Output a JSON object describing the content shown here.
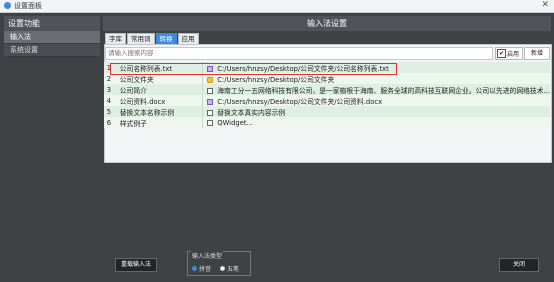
{
  "window": {
    "title": "设置面板",
    "close_label": "✕"
  },
  "sidebar": {
    "header": "设置功能",
    "items": [
      {
        "label": "输入法",
        "active": true
      },
      {
        "label": "系统设置",
        "active": false
      }
    ]
  },
  "main": {
    "header": "输入法设置",
    "tabs": [
      {
        "label": "字库",
        "active": false
      },
      {
        "label": "常用词",
        "active": false
      },
      {
        "label": "转换",
        "active": true
      },
      {
        "label": "应用",
        "active": false
      }
    ],
    "search": {
      "placeholder": "请输入搜索内容",
      "value": ""
    },
    "enable_label": "启用",
    "enable_checked": true,
    "new_label": "新增",
    "rows": [
      {
        "num": "1",
        "name": "公司名称列表.txt",
        "icon": "txt-file-icon",
        "value": "C:/Users/hnzsy/Desktop/公司文件夹/公司名称列表.txt"
      },
      {
        "num": "2",
        "name": "公司文件夹",
        "icon": "folder-icon",
        "value": "C:/Users/hnzsy/Desktop/公司文件夹"
      },
      {
        "num": "3",
        "name": "公司简介",
        "icon": "document-icon",
        "value": "海南工分一五网络科技有限公司，是一家植根于海南、服务全球的高科技互联网企业。公司以先进的网络技术..."
      },
      {
        "num": "4",
        "name": "公司资料.docx",
        "icon": "txt-file-icon",
        "value": "C:/Users/hnzsy/Desktop/公司文件夹/公司资料.docx"
      },
      {
        "num": "5",
        "name": "替换文本名称示例",
        "icon": "document-icon",
        "value": "替换文本真实内容示例"
      },
      {
        "num": "6",
        "name": "样式例子",
        "icon": "document-icon",
        "value": "QWidget..."
      }
    ]
  },
  "footer": {
    "reload_label": "重载输入法",
    "im_type_label": "输入法类型",
    "options": [
      {
        "label": "拼音",
        "checked": true
      },
      {
        "label": "五笔",
        "checked": false
      }
    ],
    "close_label": "关闭"
  }
}
